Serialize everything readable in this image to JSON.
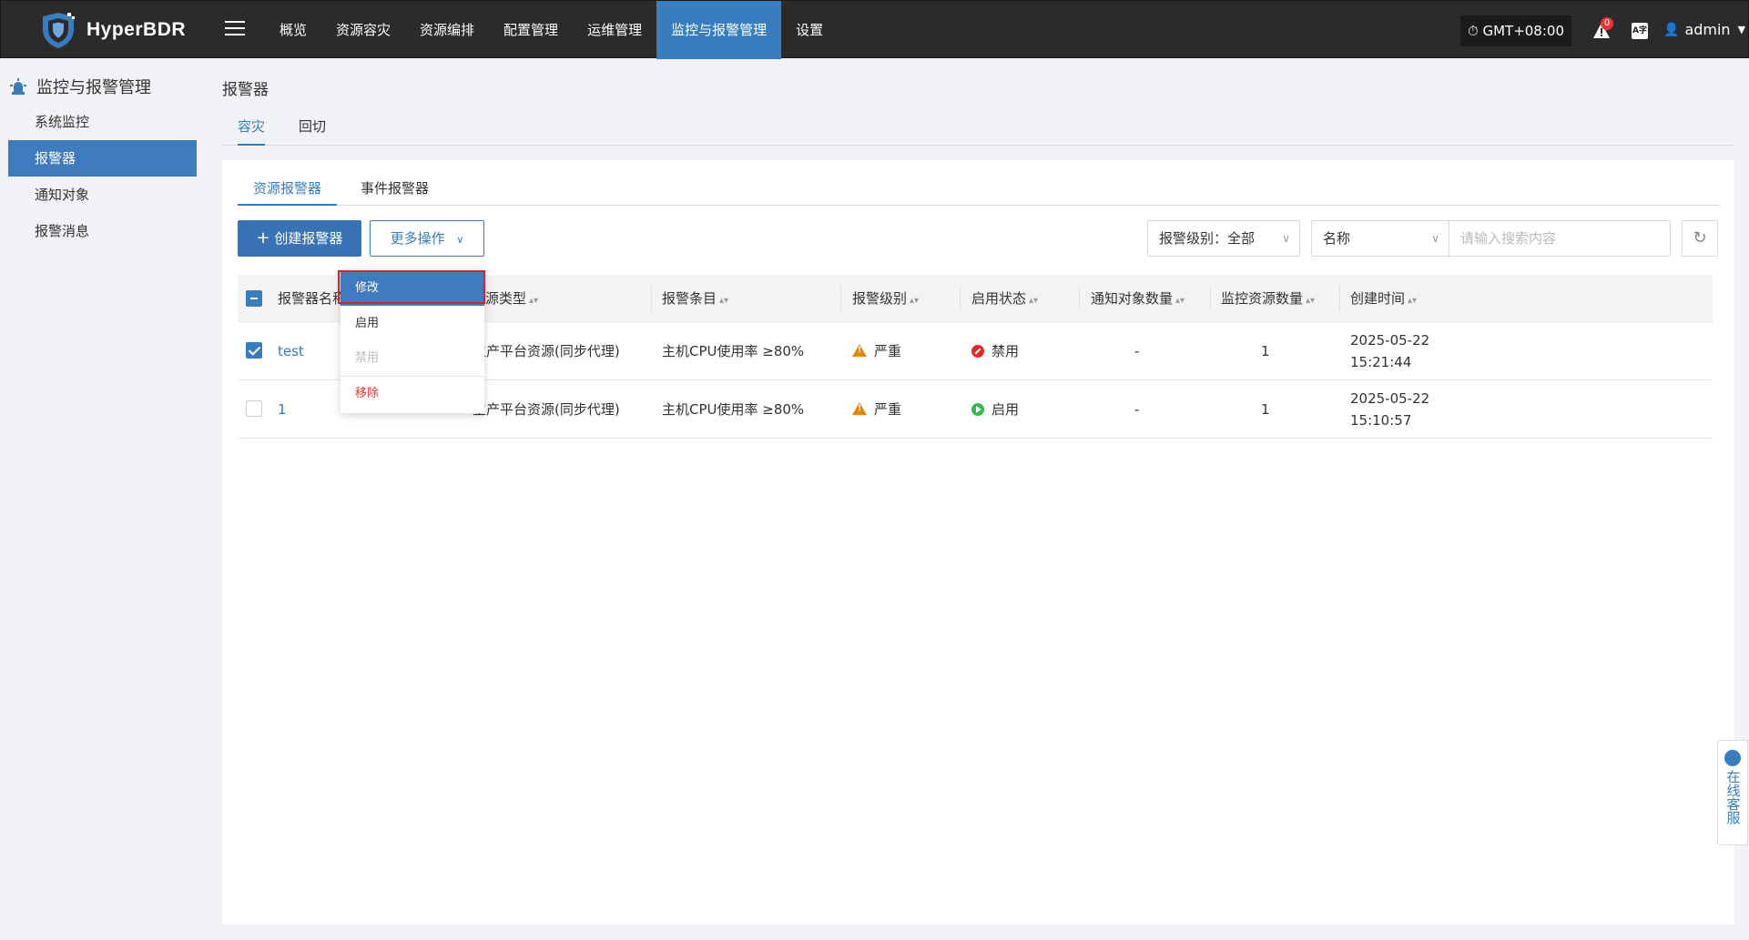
{
  "app": {
    "name": "HyperBDR"
  },
  "nav": [
    "概览",
    "资源容灾",
    "资源编排",
    "配置管理",
    "运维管理",
    "监控与报警管理",
    "设置"
  ],
  "nav_active_index": 5,
  "header": {
    "timezone": "GMT+08:00",
    "bell_count": "0",
    "lang": "A字",
    "user": "admin"
  },
  "sidebar": {
    "title": "监控与报警管理",
    "items": [
      {
        "label": "系统监控"
      },
      {
        "label": "报警器"
      },
      {
        "label": "通知对象"
      },
      {
        "label": "报警消息"
      }
    ]
  },
  "page": {
    "title": "报警器",
    "tabs": [
      "容灾",
      "回切"
    ],
    "sub_tabs": [
      "资源报警器",
      "事件报警器"
    ]
  },
  "toolbar": {
    "create": "创建报警器",
    "more": "更多操作",
    "level_filter": "报警级别：全部",
    "field_filter": "名称",
    "search_placeholder": "请输入搜索内容"
  },
  "table": {
    "headers": [
      "报警器名称",
      "资源类型",
      "报警条目",
      "报警级别",
      "启用状态",
      "通知对象数量",
      "监控资源数量",
      "创建时间"
    ],
    "rows": [
      {
        "name": "test",
        "resource_type": "生产平台资源(同步代理)",
        "item": "主机CPU使用率 ≥80%",
        "level": "严重",
        "status": "禁用",
        "notify_count": "-",
        "monitor_count": "1",
        "date": "2025-05-22",
        "time": "15:21:44",
        "checked": true
      },
      {
        "name": "1",
        "resource_type": "生产平台资源(同步代理)",
        "item": "主机CPU使用率 ≥80%",
        "level": "严重",
        "status": "启用",
        "notify_count": "-",
        "monitor_count": "1",
        "date": "2025-05-22",
        "time": "15:10:57",
        "checked": false
      }
    ]
  },
  "dropdown": [
    "修改",
    "启用",
    "禁用",
    "移除"
  ],
  "service": {
    "label": "在线客服"
  },
  "colors": {
    "primary": "#3a7dbf",
    "topbar": "#2b2b2b",
    "danger": "#e02a2a",
    "success": "#2ebc4f",
    "warning": "#e8860f"
  }
}
